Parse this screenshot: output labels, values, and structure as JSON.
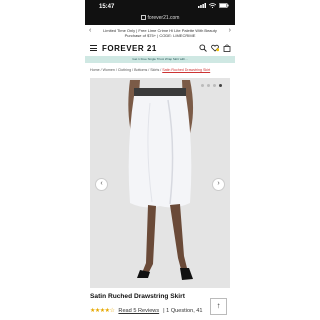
{
  "status_bar": {
    "time": "15:47"
  },
  "browser": {
    "url": "forever21.com"
  },
  "promo": {
    "text": "Limited Time Only | Free Lime Crime Hi Lite Palette With Beauty Purchase of $75+ | CODE: LIMECRIME"
  },
  "header": {
    "logo": "FOREVER 21"
  },
  "subbar": {
    "text": "Get 1 Free Single Tricot Wrap Skirt with..."
  },
  "breadcrumb": {
    "path": "Home / Women / Clothing / Bottoms / Skirts / ",
    "current": "Satin Ruched Drawstring Skirt"
  },
  "product": {
    "title": "Satin Ruched Drawstring Skirt",
    "rating": 4,
    "reviews_link": "Read 5 Reviews",
    "questions": "| 1 Question, 41"
  },
  "carousel": {
    "total": 4,
    "active": 4
  },
  "colors": {
    "accent": "#c33333",
    "star": "#e6a800",
    "banner": "#cfe8e3"
  }
}
